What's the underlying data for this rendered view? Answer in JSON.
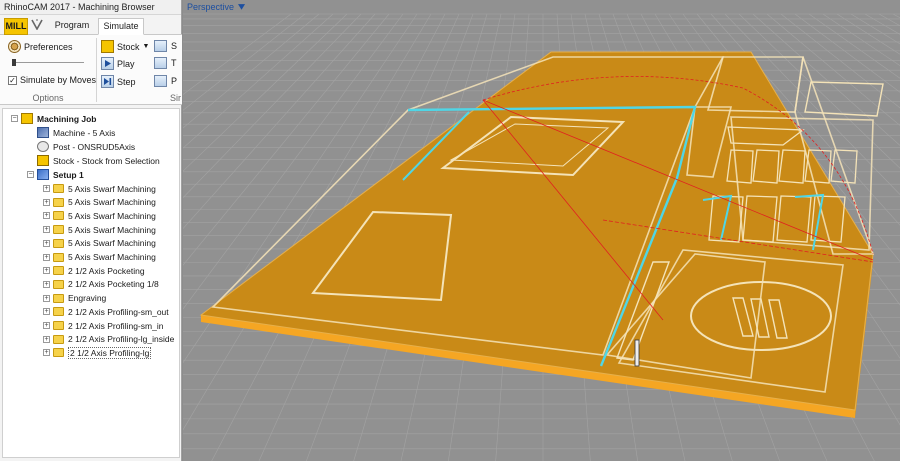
{
  "window": {
    "title": "RhinoCAM 2017 - Machining Browser"
  },
  "tabs": {
    "mill": "MILL",
    "program": "Program",
    "simulate": "Simulate"
  },
  "ribbon": {
    "preferences": "Preferences",
    "simulate_by_moves": "Simulate by Moves",
    "simulate_by_moves_checked": true,
    "options_group": "Options",
    "stock": "Stock",
    "play": "Play",
    "step": "Step",
    "sim_group": "Sir",
    "small_labels": [
      "S",
      "T",
      "P"
    ]
  },
  "tree": {
    "root": "Machining Job",
    "machine": "Machine - 5 Axis",
    "post": "Post - ONSRUD5Axis",
    "stock": "Stock - Stock from Selection",
    "setup": "Setup 1",
    "operations": [
      "5 Axis Swarf Machining",
      "5 Axis Swarf Machining",
      "5 Axis Swarf Machining",
      "5 Axis Swarf Machining",
      "5 Axis Swarf Machining",
      "5 Axis Swarf Machining",
      "2 1/2 Axis Pocketing",
      "2 1/2 Axis Pocketing 1/8",
      "Engraving",
      "2 1/2 Axis Profiling-sm_out",
      "2 1/2 Axis Profiling-sm_in",
      "2 1/2 Axis Profiling-lg_inside",
      "2 1/2 Axis Profiling-lg"
    ],
    "selected": "2 1/2 Axis Profiling-lg"
  },
  "viewport": {
    "label": "Perspective"
  },
  "colors": {
    "stock": "#c98a17",
    "stock_edge": "#f5a623",
    "toolpath": "#4fd6e6",
    "outline": "#f4e3b8",
    "guide": "#e02020",
    "grid": "#a3a3a3",
    "background": "#919191"
  }
}
